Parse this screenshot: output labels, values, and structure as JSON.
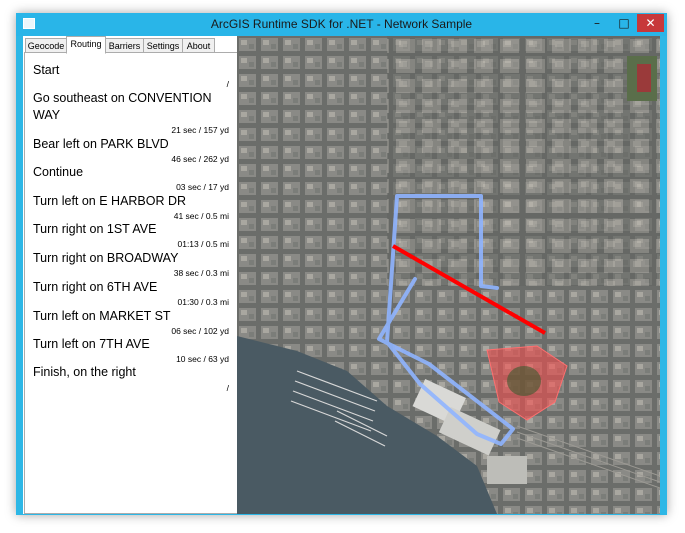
{
  "window": {
    "title": "ArcGIS Runtime SDK for .NET - Network Sample",
    "controls": {
      "minimize": "–",
      "maximize": "□",
      "close": "✕"
    }
  },
  "tabs": [
    {
      "label": "Geocode",
      "active": false
    },
    {
      "label": "Routing",
      "active": true
    },
    {
      "label": "Barriers",
      "active": false
    },
    {
      "label": "Settings",
      "active": false
    },
    {
      "label": "About",
      "active": false
    }
  ],
  "directions": [
    {
      "text": "Start",
      "meta": "/"
    },
    {
      "text": "Go southeast on CONVENTION WAY",
      "meta": "21 sec / 157 yd"
    },
    {
      "text": "Bear left on PARK BLVD",
      "meta": "46 sec / 262 yd"
    },
    {
      "text": "Continue",
      "meta": "03 sec / 17 yd"
    },
    {
      "text": "Turn left on E HARBOR DR",
      "meta": "41 sec / 0.5 mi"
    },
    {
      "text": "Turn right on 1ST AVE",
      "meta": "01:13 / 0.5 mi"
    },
    {
      "text": "Turn right on BROADWAY",
      "meta": "38 sec / 0.3 mi"
    },
    {
      "text": "Turn right on 6TH AVE",
      "meta": "01:30 / 0.3 mi"
    },
    {
      "text": "Turn left on MARKET ST",
      "meta": "06 sec / 102 yd"
    },
    {
      "text": "Turn left on 7TH AVE",
      "meta": "10 sec / 63 yd"
    },
    {
      "text": "Finish, on the right",
      "meta": "/"
    }
  ],
  "map": {
    "route_color": "#8fb4ff",
    "barrier_line_color": "#ff0000",
    "barrier_polygon_color": "#ff4a4a",
    "water_color": "#4a5a63"
  }
}
